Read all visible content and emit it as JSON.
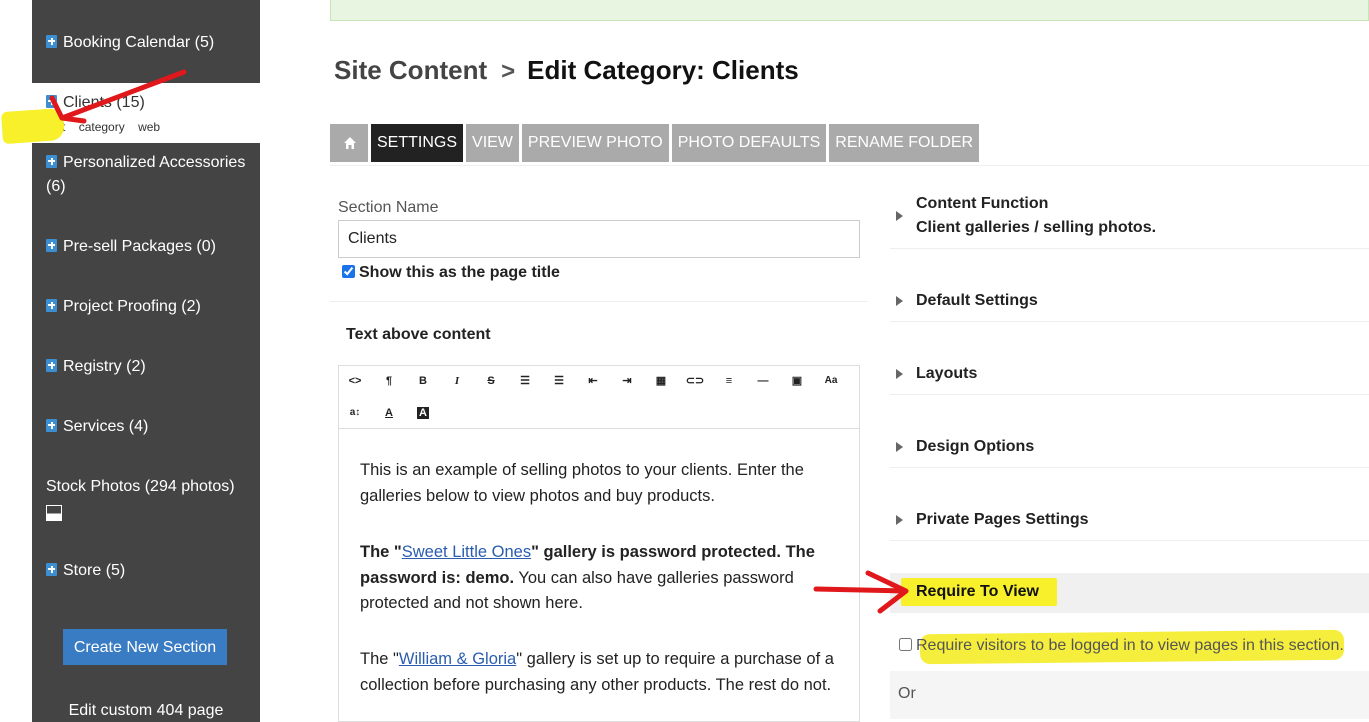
{
  "sidebar": {
    "items": [
      {
        "label": "Booking Calendar (5)"
      },
      {
        "label": "Clients (15)",
        "sub": [
          "edit",
          "category",
          "web"
        ]
      },
      {
        "label": "Personalized Accessories (6)"
      },
      {
        "label": "Pre-sell Packages (0)"
      },
      {
        "label": "Project Proofing (2)"
      },
      {
        "label": "Registry (2)"
      },
      {
        "label": "Services (4)"
      },
      {
        "label": "Stock Photos (294 photos)"
      },
      {
        "label": "Store (5)"
      }
    ],
    "create_button": "Create New Section",
    "edit_404": "Edit custom 404 page"
  },
  "breadcrumb": {
    "root": "Site Content",
    "current": "Edit Category: Clients"
  },
  "tabs": [
    "SETTINGS",
    "VIEW",
    "PREVIEW PHOTO",
    "PHOTO DEFAULTS",
    "RENAME FOLDER"
  ],
  "form": {
    "section_name_label": "Section Name",
    "section_name_value": "Clients",
    "page_title_label": "Show this as the page title",
    "page_title_checked": true,
    "text_above_label": "Text above content"
  },
  "editor": {
    "toolbar": [
      "code-view",
      "paragraph",
      "bold",
      "italic",
      "strikethrough",
      "unordered-list",
      "ordered-list",
      "outdent",
      "indent",
      "table",
      "link",
      "align",
      "horizontal-rule",
      "video",
      "font-size",
      "line-height",
      "text-color",
      "background-color"
    ],
    "p1": "This is an example of selling photos to your clients. Enter the galleries below to view photos and buy products.",
    "p2_pre": "The \"",
    "p2_link": "Sweet Little Ones",
    "p2_bold": "\" gallery is password protected. The password is: demo.",
    "p2_rest": " You can also have galleries password protected and not shown here.",
    "p3_pre": "The \"",
    "p3_link": "William & Gloria",
    "p3_rest": "\" gallery is set up to require a purchase of a collection before purchasing any other products. The rest do not."
  },
  "right_panel": {
    "content_function_title": "Content Function",
    "content_function_value": "Client galleries / selling photos.",
    "sections": [
      "Default Settings",
      "Layouts",
      "Design Options",
      "Private Pages Settings"
    ],
    "require_title": "Require To View",
    "require_login_label": "Require visitors to be logged in to view pages in this section.",
    "require_login_checked": false,
    "or_label": "Or"
  },
  "colors": {
    "sidebar_bg": "#444444",
    "accent_blue": "#3a7cc4",
    "highlight_yellow": "#f7f02a",
    "annotation_red": "#e0181b"
  }
}
